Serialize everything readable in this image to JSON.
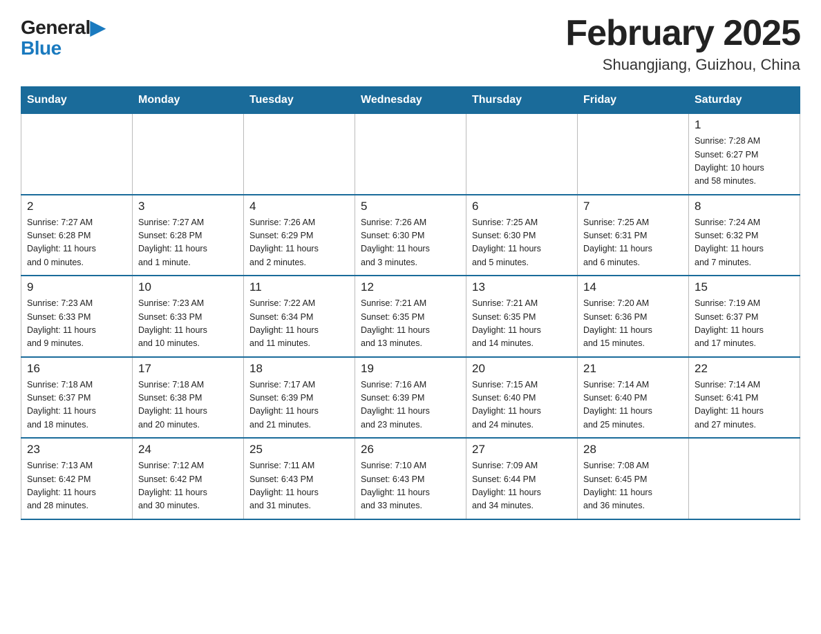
{
  "header": {
    "logo_general": "General",
    "logo_blue": "Blue",
    "title": "February 2025",
    "subtitle": "Shuangjiang, Guizhou, China"
  },
  "calendar": {
    "days_of_week": [
      "Sunday",
      "Monday",
      "Tuesday",
      "Wednesday",
      "Thursday",
      "Friday",
      "Saturday"
    ],
    "weeks": [
      [
        {
          "day": "",
          "info": ""
        },
        {
          "day": "",
          "info": ""
        },
        {
          "day": "",
          "info": ""
        },
        {
          "day": "",
          "info": ""
        },
        {
          "day": "",
          "info": ""
        },
        {
          "day": "",
          "info": ""
        },
        {
          "day": "1",
          "info": "Sunrise: 7:28 AM\nSunset: 6:27 PM\nDaylight: 10 hours\nand 58 minutes."
        }
      ],
      [
        {
          "day": "2",
          "info": "Sunrise: 7:27 AM\nSunset: 6:28 PM\nDaylight: 11 hours\nand 0 minutes."
        },
        {
          "day": "3",
          "info": "Sunrise: 7:27 AM\nSunset: 6:28 PM\nDaylight: 11 hours\nand 1 minute."
        },
        {
          "day": "4",
          "info": "Sunrise: 7:26 AM\nSunset: 6:29 PM\nDaylight: 11 hours\nand 2 minutes."
        },
        {
          "day": "5",
          "info": "Sunrise: 7:26 AM\nSunset: 6:30 PM\nDaylight: 11 hours\nand 3 minutes."
        },
        {
          "day": "6",
          "info": "Sunrise: 7:25 AM\nSunset: 6:30 PM\nDaylight: 11 hours\nand 5 minutes."
        },
        {
          "day": "7",
          "info": "Sunrise: 7:25 AM\nSunset: 6:31 PM\nDaylight: 11 hours\nand 6 minutes."
        },
        {
          "day": "8",
          "info": "Sunrise: 7:24 AM\nSunset: 6:32 PM\nDaylight: 11 hours\nand 7 minutes."
        }
      ],
      [
        {
          "day": "9",
          "info": "Sunrise: 7:23 AM\nSunset: 6:33 PM\nDaylight: 11 hours\nand 9 minutes."
        },
        {
          "day": "10",
          "info": "Sunrise: 7:23 AM\nSunset: 6:33 PM\nDaylight: 11 hours\nand 10 minutes."
        },
        {
          "day": "11",
          "info": "Sunrise: 7:22 AM\nSunset: 6:34 PM\nDaylight: 11 hours\nand 11 minutes."
        },
        {
          "day": "12",
          "info": "Sunrise: 7:21 AM\nSunset: 6:35 PM\nDaylight: 11 hours\nand 13 minutes."
        },
        {
          "day": "13",
          "info": "Sunrise: 7:21 AM\nSunset: 6:35 PM\nDaylight: 11 hours\nand 14 minutes."
        },
        {
          "day": "14",
          "info": "Sunrise: 7:20 AM\nSunset: 6:36 PM\nDaylight: 11 hours\nand 15 minutes."
        },
        {
          "day": "15",
          "info": "Sunrise: 7:19 AM\nSunset: 6:37 PM\nDaylight: 11 hours\nand 17 minutes."
        }
      ],
      [
        {
          "day": "16",
          "info": "Sunrise: 7:18 AM\nSunset: 6:37 PM\nDaylight: 11 hours\nand 18 minutes."
        },
        {
          "day": "17",
          "info": "Sunrise: 7:18 AM\nSunset: 6:38 PM\nDaylight: 11 hours\nand 20 minutes."
        },
        {
          "day": "18",
          "info": "Sunrise: 7:17 AM\nSunset: 6:39 PM\nDaylight: 11 hours\nand 21 minutes."
        },
        {
          "day": "19",
          "info": "Sunrise: 7:16 AM\nSunset: 6:39 PM\nDaylight: 11 hours\nand 23 minutes."
        },
        {
          "day": "20",
          "info": "Sunrise: 7:15 AM\nSunset: 6:40 PM\nDaylight: 11 hours\nand 24 minutes."
        },
        {
          "day": "21",
          "info": "Sunrise: 7:14 AM\nSunset: 6:40 PM\nDaylight: 11 hours\nand 25 minutes."
        },
        {
          "day": "22",
          "info": "Sunrise: 7:14 AM\nSunset: 6:41 PM\nDaylight: 11 hours\nand 27 minutes."
        }
      ],
      [
        {
          "day": "23",
          "info": "Sunrise: 7:13 AM\nSunset: 6:42 PM\nDaylight: 11 hours\nand 28 minutes."
        },
        {
          "day": "24",
          "info": "Sunrise: 7:12 AM\nSunset: 6:42 PM\nDaylight: 11 hours\nand 30 minutes."
        },
        {
          "day": "25",
          "info": "Sunrise: 7:11 AM\nSunset: 6:43 PM\nDaylight: 11 hours\nand 31 minutes."
        },
        {
          "day": "26",
          "info": "Sunrise: 7:10 AM\nSunset: 6:43 PM\nDaylight: 11 hours\nand 33 minutes."
        },
        {
          "day": "27",
          "info": "Sunrise: 7:09 AM\nSunset: 6:44 PM\nDaylight: 11 hours\nand 34 minutes."
        },
        {
          "day": "28",
          "info": "Sunrise: 7:08 AM\nSunset: 6:45 PM\nDaylight: 11 hours\nand 36 minutes."
        },
        {
          "day": "",
          "info": ""
        }
      ]
    ]
  }
}
